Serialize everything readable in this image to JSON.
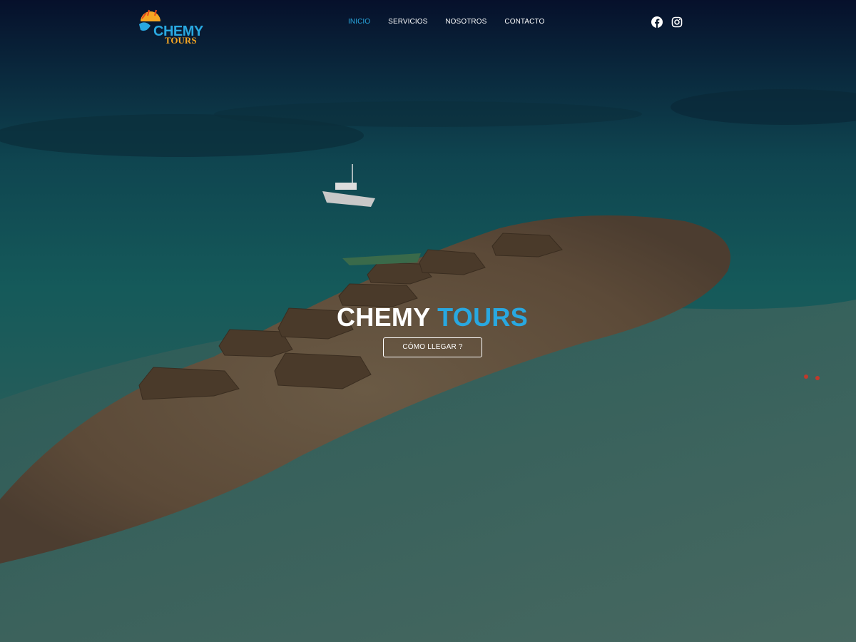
{
  "brand": {
    "logo_name": "CHEMY",
    "logo_sub": "TOURS"
  },
  "nav": {
    "items": [
      {
        "label": "INICIO",
        "active": true
      },
      {
        "label": "SERVICIOS",
        "active": false
      },
      {
        "label": "NOSOTROS",
        "active": false
      },
      {
        "label": "CONTACTO",
        "active": false
      }
    ]
  },
  "social": {
    "icons": [
      "facebook-icon",
      "instagram-icon"
    ]
  },
  "hero": {
    "title_main": "CHEMY",
    "title_accent": "TOURS",
    "cta_label": "CÓMO LLEGAR ?"
  },
  "colors": {
    "accent": "#29a8e0",
    "logo_orange": "#f5a623",
    "text": "#ffffff"
  }
}
